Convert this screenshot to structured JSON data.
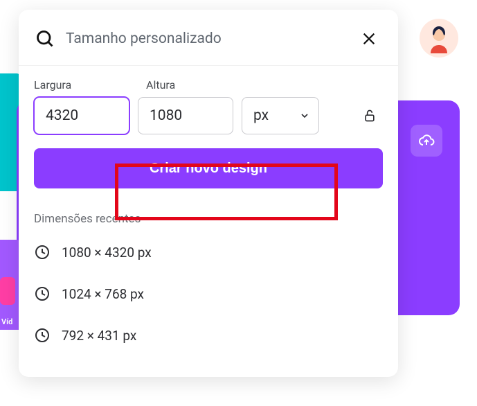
{
  "search": {
    "text": "Tamanho personalizado"
  },
  "dimensions": {
    "width_label": "Largura",
    "height_label": "Altura",
    "width_value": "4320",
    "height_value": "1080",
    "unit": "px"
  },
  "create_button_label": "Criar novo design",
  "recent": {
    "title": "Dimensões recentes",
    "items": [
      {
        "label": "1080 × 4320 px"
      },
      {
        "label": "1024 × 768 px"
      },
      {
        "label": "792 × 431 px"
      }
    ]
  },
  "sidebar_label": "Víd"
}
